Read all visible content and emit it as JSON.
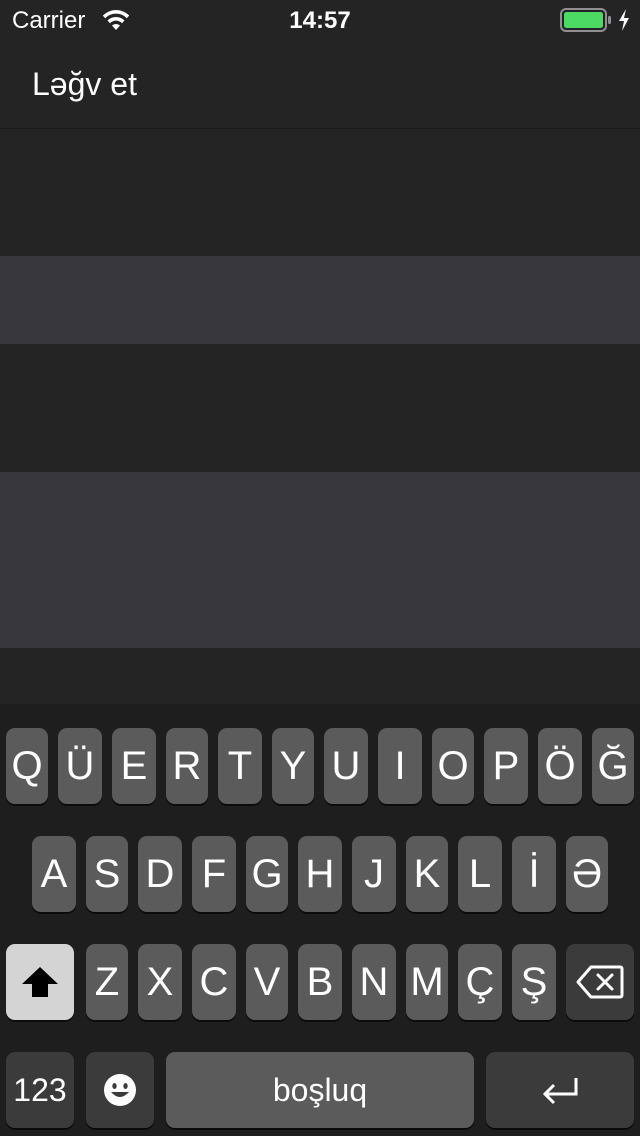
{
  "status_bar": {
    "carrier": "Carrier",
    "time": "14:57",
    "battery_color": "#4cd964"
  },
  "nav": {
    "cancel_label": "Ləğv et"
  },
  "keyboard": {
    "row1": [
      "Q",
      "Ü",
      "E",
      "R",
      "T",
      "Y",
      "U",
      "I",
      "O",
      "P",
      "Ö",
      "Ğ"
    ],
    "row2": [
      "A",
      "S",
      "D",
      "F",
      "G",
      "H",
      "J",
      "K",
      "L",
      "İ",
      "Ə"
    ],
    "row3": [
      "Z",
      "X",
      "C",
      "V",
      "B",
      "N",
      "M",
      "Ç",
      "Ş"
    ],
    "numbers_label": "123",
    "space_label": "boşluq",
    "icons": {
      "shift": "shift-arrow-icon",
      "backspace": "backspace-icon",
      "emoji": "emoji-icon",
      "return": "return-arrow-icon"
    }
  }
}
